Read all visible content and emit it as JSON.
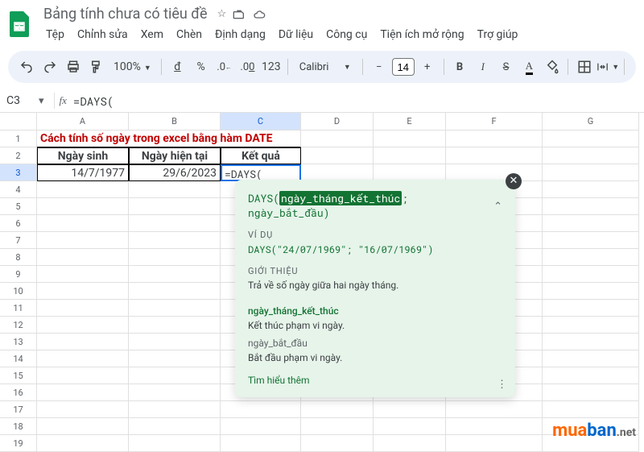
{
  "header": {
    "doc_title": "Bảng tính chưa có tiêu đề",
    "menus": [
      "Tệp",
      "Chỉnh sửa",
      "Xem",
      "Chèn",
      "Định dạng",
      "Dữ liệu",
      "Công cụ",
      "Tiện ích mở rộng",
      "Trợ giúp"
    ]
  },
  "toolbar": {
    "zoom": "100%",
    "currency": "đ",
    "percent": "%",
    "dec_dec": ".0",
    "inc_dec": ".00",
    "num_fmt": "123",
    "font": "Calibri",
    "size": "14",
    "bold": "B",
    "italic": "I",
    "strike": "S",
    "minus": "−",
    "plus": "+"
  },
  "namebox": {
    "ref": "C3",
    "formula": "=DAYS("
  },
  "columns": [
    "A",
    "B",
    "C",
    "D",
    "E",
    "F",
    "G"
  ],
  "rows_visible": 19,
  "cells": {
    "a1": "Cách tính số ngày trong excel bằng hàm DATE",
    "a2": "Ngày sinh",
    "b2": "Ngày hiện tại",
    "c2": "Kết quả",
    "a3": "14/7/1977",
    "b3": "29/6/2023",
    "c3": "=DAYS("
  },
  "tooltip": {
    "fn": "DAYS(",
    "arg1": "ngày_tháng_kết_thúc",
    "sep": "; ",
    "arg2": "ngày_bắt_đầu",
    "close": ")",
    "ex_label": "VÍ DỤ",
    "ex": "DAYS(\"24/07/1969\"; \"16/07/1969\")",
    "intro_label": "GIỚI THIỆU",
    "intro": "Trả về số ngày giữa hai ngày tháng.",
    "p1_name": "ngày_tháng_kết_thúc",
    "p1_desc": "Kết thúc phạm vi ngày.",
    "p2_name": "ngày_bắt_đầu",
    "p2_desc": "Bắt đầu phạm vi ngày.",
    "learn": "Tìm hiểu thêm"
  },
  "watermark": {
    "p1": "mua",
    "p2": "ban",
    "p3": ".net"
  }
}
